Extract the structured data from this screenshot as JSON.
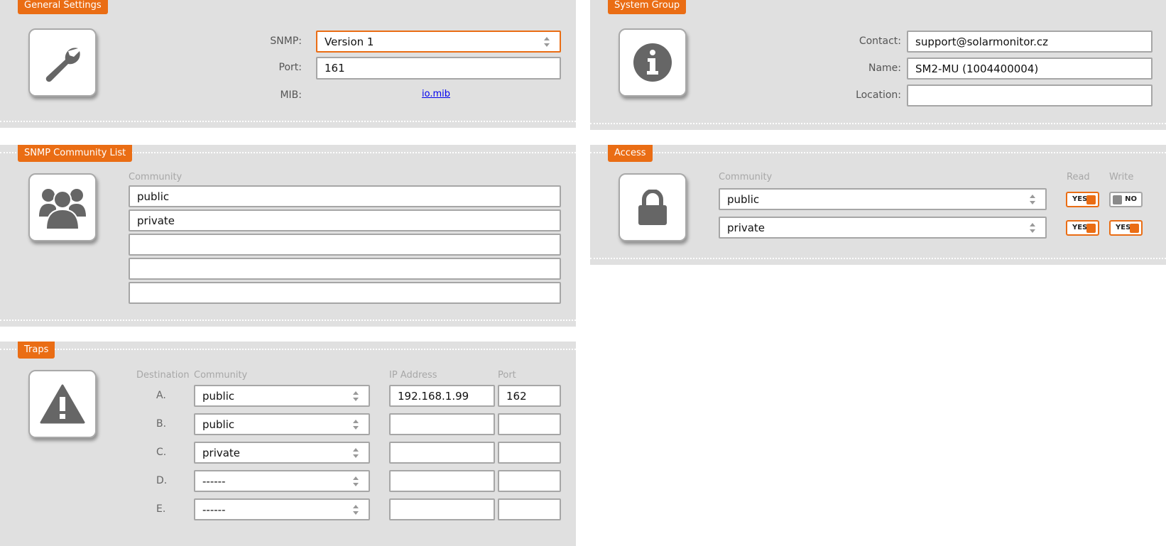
{
  "general": {
    "title": "General Settings",
    "snmp_label": "SNMP:",
    "snmp_value": "Version 1",
    "port_label": "Port:",
    "port_value": "161",
    "mib_label": "MIB:",
    "mib_link": "io.mib"
  },
  "system": {
    "title": "System Group",
    "contact_label": "Contact:",
    "contact_value": "support@solarmonitor.cz",
    "name_label": "Name:",
    "name_value": "SM2-MU (1004400004)",
    "location_label": "Location:",
    "location_value": ""
  },
  "community": {
    "title": "SNMP Community List",
    "header": "Community",
    "items": [
      "public",
      "private",
      "",
      "",
      ""
    ]
  },
  "access": {
    "title": "Access",
    "header_community": "Community",
    "header_read": "Read",
    "header_write": "Write",
    "rows": [
      {
        "community": "public",
        "read": "YES",
        "write": "NO"
      },
      {
        "community": "private",
        "read": "YES",
        "write": "YES"
      }
    ]
  },
  "traps": {
    "title": "Traps",
    "header_destination": "Destination",
    "header_community": "Community",
    "header_ip": "IP Address",
    "header_port": "Port",
    "rows": [
      {
        "dest": "A.",
        "community": "public",
        "ip": "192.168.1.99",
        "port": "162"
      },
      {
        "dest": "B.",
        "community": "public",
        "ip": "",
        "port": ""
      },
      {
        "dest": "C.",
        "community": "private",
        "ip": "",
        "port": ""
      },
      {
        "dest": "D.",
        "community": "------",
        "ip": "",
        "port": ""
      },
      {
        "dest": "E.",
        "community": "------",
        "ip": "",
        "port": ""
      }
    ]
  },
  "icons": {
    "general": "wrench-icon",
    "system": "info-icon",
    "community": "users-icon",
    "access": "lock-icon",
    "traps": "warning-icon"
  },
  "colors": {
    "accent": "#ea6d14",
    "panel": "#e0e0e0",
    "icon": "#666666"
  }
}
